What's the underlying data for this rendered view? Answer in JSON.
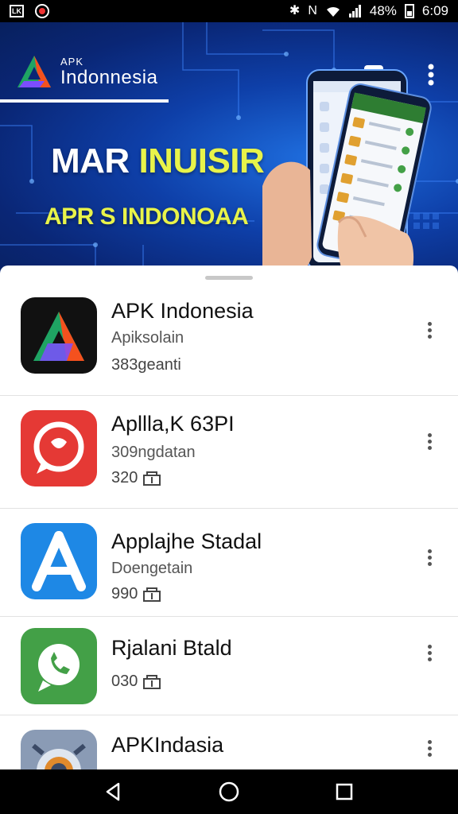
{
  "status_bar": {
    "left_icons": [
      "notification-box-icon",
      "do-not-disturb-icon"
    ],
    "notification_label": "LK",
    "right_icons": [
      "bluetooth-icon",
      "nfc-icon",
      "wifi-icon",
      "signal-icon",
      "battery-icon"
    ],
    "battery": "48%",
    "time": "6:09"
  },
  "header": {
    "brand_small": "APK",
    "brand_name": "Indonnesia",
    "actions": [
      "feedback-icon",
      "more-vertical-icon"
    ]
  },
  "hero": {
    "line1_white": "MAR ",
    "line1_accent": "INUISIR",
    "line2": "APR S INDONOAA"
  },
  "apps": [
    {
      "title": "APK Indonesia",
      "subtitle": "Apiksolain",
      "meta": "383geanti",
      "icon": "apk-logo-icon",
      "color": "#111111"
    },
    {
      "title": "Apllla,K 63PI",
      "subtitle": "309ngdatan",
      "meta": "320",
      "icon": "chat-bubble-icon",
      "color": "#e53935"
    },
    {
      "title": "Applajhe Stadal",
      "subtitle": "Doengetain",
      "meta": "990",
      "icon": "app-store-a-icon",
      "color": "#1e88e5"
    },
    {
      "title": "Rjalani Btald",
      "subtitle": "",
      "meta": "030",
      "icon": "phone-chat-icon",
      "color": "#43a047"
    },
    {
      "title": "APKIndasia",
      "subtitle": "",
      "meta": "",
      "icon": "camera-app-icon",
      "color": "#8a9bb5"
    }
  ],
  "nav": [
    "back-icon",
    "home-icon",
    "recents-icon"
  ]
}
